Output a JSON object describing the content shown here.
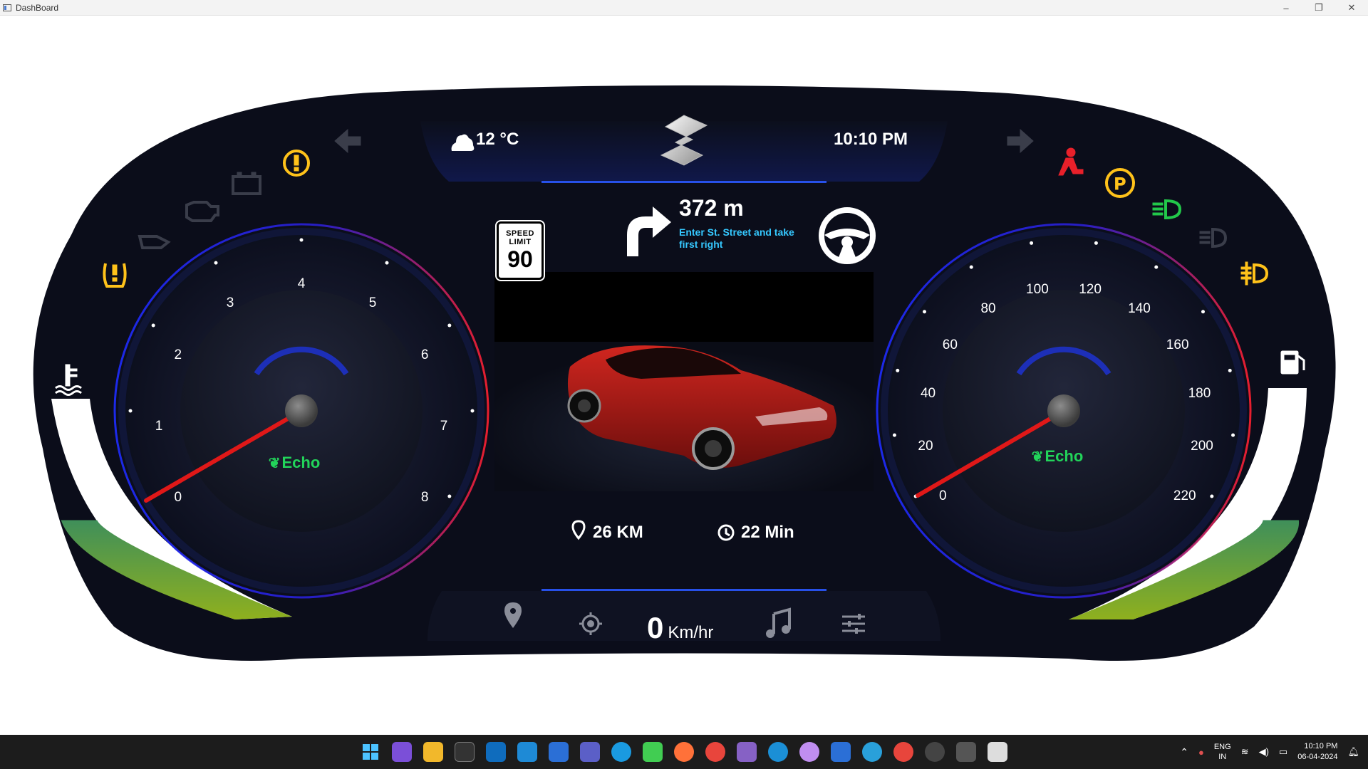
{
  "window": {
    "title": "DashBoard",
    "controls": [
      "–",
      "❐",
      "✕"
    ]
  },
  "top_bar": {
    "temperature": "12 °C",
    "time": "10:10 PM"
  },
  "speed_limit": {
    "label": "SPEED LIMIT",
    "value": "90"
  },
  "navigation": {
    "distance": "372 m",
    "instruction": "Enter St. Street and take first right"
  },
  "trip": {
    "distance": "26 KM",
    "duration": "22 Min"
  },
  "speed_readout": {
    "value": "0",
    "unit": "Km/hr"
  },
  "rpm_gauge": {
    "ticks": [
      "0",
      "1",
      "2",
      "3",
      "4",
      "5",
      "6",
      "7",
      "8"
    ],
    "value": 0,
    "mode": "Echo"
  },
  "speed_gauge": {
    "ticks": [
      "0",
      "20",
      "40",
      "60",
      "80",
      "100",
      "120",
      "140",
      "160",
      "180",
      "200",
      "220"
    ],
    "value": 0,
    "mode": "Echo"
  },
  "levels": {
    "temperature_level": 0.45,
    "fuel_level": 0.45
  },
  "warning_icons": [
    {
      "name": "turn-left-icon",
      "color": "#3a3d4a"
    },
    {
      "name": "brake-warning-icon",
      "color": "#ffc21a"
    },
    {
      "name": "battery-icon",
      "color": "#3a3d4a"
    },
    {
      "name": "engine-check-icon",
      "color": "#3a3d4a"
    },
    {
      "name": "oil-pressure-icon",
      "color": "#3a3d4a"
    },
    {
      "name": "tire-pressure-icon",
      "color": "#ffc21a"
    },
    {
      "name": "coolant-temp-icon",
      "color": "#ffffff"
    },
    {
      "name": "turn-right-icon",
      "color": "#3a3d4a"
    },
    {
      "name": "seatbelt-icon",
      "color": "#e8202a"
    },
    {
      "name": "parking-brake-icon",
      "color": "#ffc21a"
    },
    {
      "name": "low-beam-icon",
      "color": "#22c84a"
    },
    {
      "name": "high-beam-icon",
      "color": "#3a3d4a"
    },
    {
      "name": "fog-light-icon",
      "color": "#ffc21a"
    },
    {
      "name": "fuel-icon",
      "color": "#ffffff"
    }
  ],
  "bottom_menu": [
    "location-icon",
    "gps-target-icon",
    "music-icon",
    "settings-sliders-icon"
  ],
  "taskbar": {
    "language": "ENG",
    "region": "IN",
    "time": "10:10 PM",
    "date": "06-04-2024"
  }
}
